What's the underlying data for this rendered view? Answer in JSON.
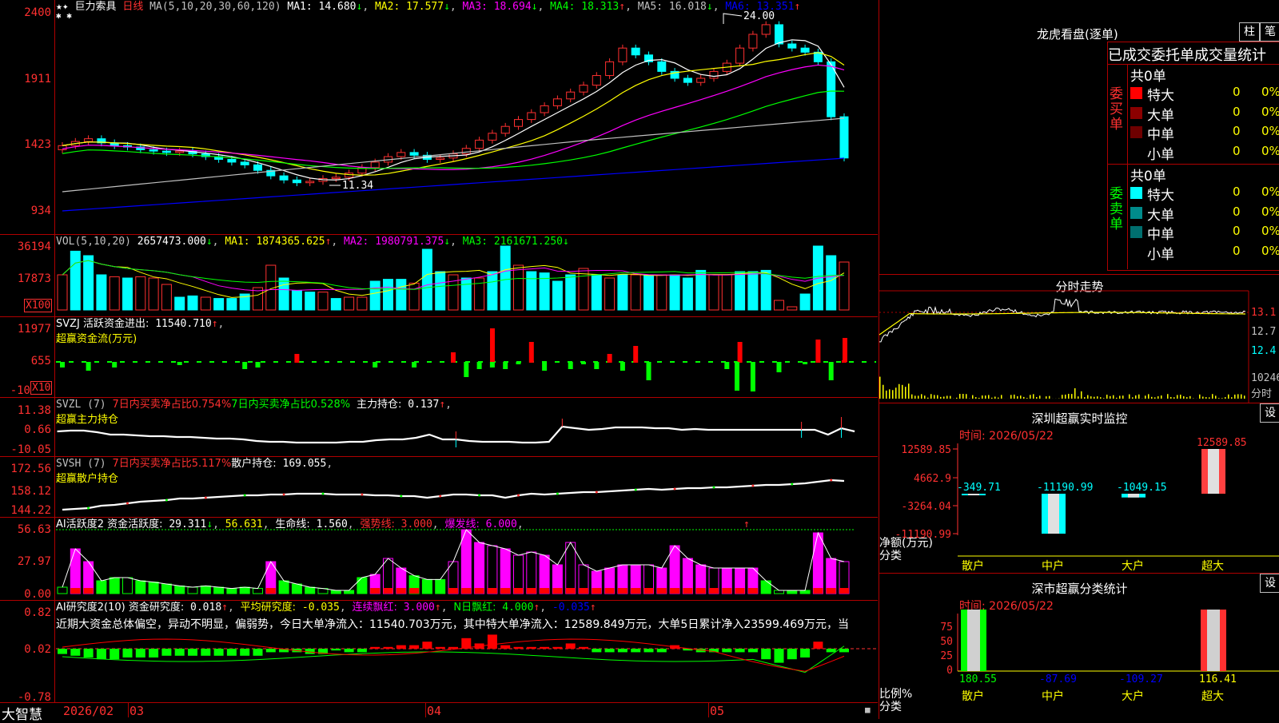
{
  "app": {
    "brand": "大智慧"
  },
  "kline": {
    "stock_name": "巨力索具",
    "period": "日线",
    "ma_params": "MA(5,10,20,30,60,120)",
    "ma": [
      {
        "label": "MA1:",
        "value": "14.680",
        "arrow": "↓",
        "color": "#ffffff"
      },
      {
        "label": "MA2:",
        "value": "17.577",
        "arrow": "↓",
        "color": "#ffff00"
      },
      {
        "label": "MA3:",
        "value": "18.694",
        "arrow": "↓",
        "color": "#ff00ff"
      },
      {
        "label": "MA4:",
        "value": "18.313",
        "arrow": "↑",
        "color": "#00ff00"
      },
      {
        "label": "MA5:",
        "value": "16.018",
        "arrow": "↓",
        "color": "#c0c0c0"
      },
      {
        "label": "MA6:",
        "value": "13.351",
        "arrow": "↑",
        "color": "#0000ff"
      }
    ],
    "y_ticks": [
      "2400",
      "1911",
      "1423",
      "934"
    ],
    "max_label": "24.00",
    "min_label": "11.34"
  },
  "vol": {
    "header": "VOL(5,10,20)",
    "value": "2657473.000",
    "value_arrow": "↓",
    "ma": [
      {
        "label": "MA1:",
        "value": "1874365.625",
        "arrow": "↑",
        "color": "#ffff00"
      },
      {
        "label": "MA2:",
        "value": "1980791.375",
        "arrow": "↓",
        "color": "#ff00ff"
      },
      {
        "label": "MA3:",
        "value": "2161671.250",
        "arrow": "↓",
        "color": "#00ff00"
      }
    ],
    "y_ticks": [
      "36194",
      "17873"
    ],
    "unit_badge": "X100"
  },
  "svzj": {
    "header": "SVZJ  活跃资金进出:",
    "value": "11540.710",
    "value_arrow": "↑",
    "sub": "超赢资金流(万元)",
    "y_ticks": [
      "11977",
      "655",
      "-10"
    ],
    "unit_badge": "X10"
  },
  "svzl": {
    "header": "SVZL (7)",
    "t1": "7日内买卖净占比0.754%",
    "t2": "7日内买卖净占比0.528%",
    "t3": "主力持仓:",
    "t3v": "0.137",
    "t3a": "↑",
    "sub": "超赢主力持仓",
    "y_ticks": [
      "11.38",
      "0.66",
      "-10.05"
    ]
  },
  "svsh": {
    "header": "SVSH (7)",
    "t1": "7日内买卖净占比5.117%",
    "t2": "散户持仓:",
    "t2v": "169.055",
    "sub": "超赢散户持仓",
    "y_ticks": [
      "172.56",
      "158.12",
      "144.22"
    ]
  },
  "ai_active": {
    "header": "AI活跃度2 资金活跃度:",
    "v1": "29.311",
    "a1": "↓",
    "v2": "56.631",
    "t3": "生命线:",
    "v3": "1.560",
    "t4": "强势线:",
    "v4": "3.000",
    "t5": "爆发线:",
    "v5": "6.000",
    "y_ticks": [
      "56.63",
      "27.97",
      "0.00"
    ]
  },
  "ai_research": {
    "header": "AI研究度2(10) 资金研究度:",
    "v1": "0.018",
    "a1": "↑",
    "t2": "平均研究度:",
    "v2": "-0.035",
    "t3": "连续飘红:",
    "v3": "3.000",
    "t4": "N日飘红:",
    "v4": "4.000",
    "v5": "-0.035",
    "commentary": "近期大资金总体偏空，异动不明显，偏弱势，今日大单净流入：11540.703万元，其中特大单净流入：12589.849万元，大单5日累计净入23599.469万元，当",
    "y_ticks": [
      "0.82",
      "0.02",
      "-0.78"
    ]
  },
  "x_axis": {
    "labels": [
      "2026/02",
      "03",
      "04",
      "05"
    ]
  },
  "longhu": {
    "title": "龙虎看盘(逐单)",
    "btn1": "柱",
    "btn2": "笔",
    "table_title": "已成交委托单成交量统计",
    "buy_side": "委买单",
    "sell_side": "委卖单",
    "buy_total": "共0单",
    "sell_total": "共0单",
    "buy_rows": [
      {
        "name": "特大",
        "count": "0",
        "pct": "0%",
        "color": "#ff0000"
      },
      {
        "name": "大单",
        "count": "0",
        "pct": "0%",
        "color": "#8b0000"
      },
      {
        "name": "中单",
        "count": "0",
        "pct": "0%",
        "color": "#6e0000"
      },
      {
        "name": "小单",
        "count": "0",
        "pct": "0%",
        "color": "#000000"
      }
    ],
    "sell_rows": [
      {
        "name": "特大",
        "count": "0",
        "pct": "0%",
        "color": "#00ffff"
      },
      {
        "name": "大单",
        "count": "0",
        "pct": "0%",
        "color": "#008b8b"
      },
      {
        "name": "中单",
        "count": "0",
        "pct": "0%",
        "color": "#006e6e"
      },
      {
        "name": "小单",
        "count": "0",
        "pct": "0%",
        "color": "#000000"
      }
    ]
  },
  "intraday": {
    "title": "分时走势",
    "prices": [
      "13.1",
      "12.7",
      "12.4"
    ],
    "vol_label": "10246",
    "vol_unit": "分时"
  },
  "monitor": {
    "title": "深圳超赢实时监控",
    "btn": "设",
    "time": "时间: 2026/05/22",
    "y_ticks": [
      "12589.85",
      "4662.9",
      "-3264.04",
      "-11190.99"
    ],
    "ylabel": "净额(万元)",
    "xlabel": "分类",
    "top_label": "12589.85",
    "categories": [
      "散户",
      "中户",
      "大户",
      "超大"
    ],
    "value_labels": [
      "-349.71",
      "-11190.99",
      "-1049.15",
      "12589.85"
    ]
  },
  "class_stats": {
    "title": "深市超赢分类统计",
    "btn": "设",
    "time": "时间: 2026/05/22",
    "y_ticks": [
      "75",
      "50",
      "25",
      "0"
    ],
    "ylabel": "比例%",
    "xlabel": "分类",
    "categories": [
      "散户",
      "中户",
      "大户",
      "超大"
    ],
    "value_labels": [
      "180.55",
      "-87.69",
      "-109.27",
      "116.41"
    ]
  },
  "chart_data": [
    {
      "type": "bar",
      "title": "深圳超赢实时监控",
      "ylabel": "净额(万元)",
      "categories": [
        "散户",
        "中户",
        "大户",
        "超大"
      ],
      "values": [
        -349.71,
        -11190.99,
        -1049.15,
        12589.85
      ],
      "ylim": [
        -11190.99,
        12589.85
      ]
    },
    {
      "type": "bar",
      "title": "深市超赢分类统计",
      "ylabel": "比例%",
      "categories": [
        "散户",
        "中户",
        "大户",
        "超大"
      ],
      "values": [
        180.55,
        -87.69,
        -109.27,
        116.41
      ],
      "ylim": [
        0,
        75
      ]
    },
    {
      "type": "line",
      "title": "分时走势",
      "y_ticks": [
        13.1,
        12.7,
        12.4
      ]
    }
  ]
}
